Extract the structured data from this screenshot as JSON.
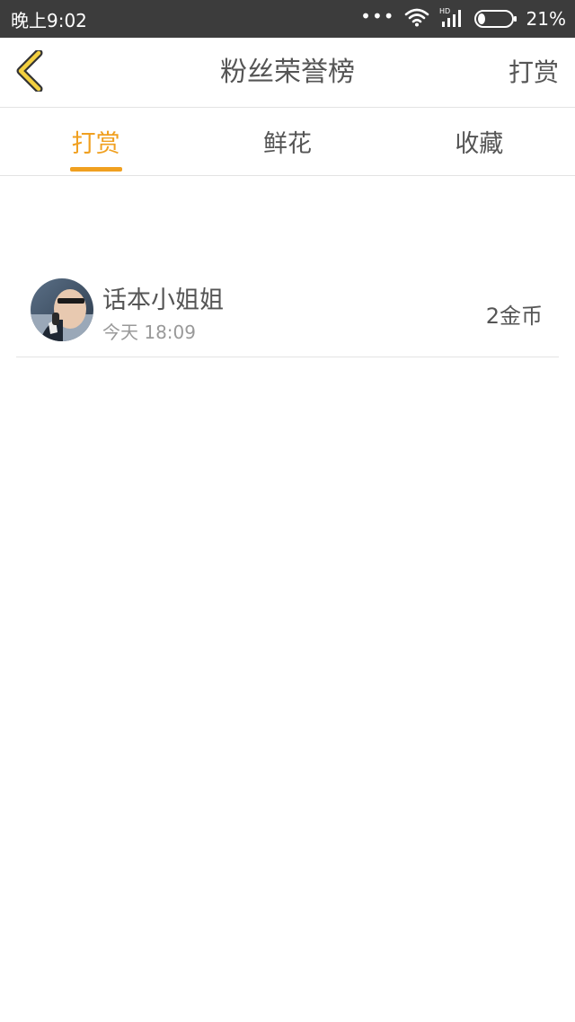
{
  "status_bar": {
    "time": "晚上9:02",
    "signal_type": "HD",
    "battery_percent": "21%",
    "battery_level": 0.21,
    "icons": [
      "more-dots-icon",
      "wifi-icon",
      "cellular-signal-icon",
      "battery-icon"
    ]
  },
  "nav": {
    "back_icon": "chevron-left-icon",
    "title": "粉丝荣誉榜",
    "action_label": "打赏"
  },
  "tabs": [
    {
      "label": "打赏",
      "active": true
    },
    {
      "label": "鲜花",
      "active": false
    },
    {
      "label": "收藏",
      "active": false
    }
  ],
  "list": {
    "items": [
      {
        "name": "话本小姐姐",
        "time": "今天 18:09",
        "amount": "2金币",
        "avatar": "user-avatar-photo"
      }
    ]
  },
  "colors": {
    "accent": "#f0a020",
    "status_bar": "#3c3c3c",
    "text_primary": "#555555",
    "text_secondary": "#999999",
    "divider": "#e3e3e3",
    "back_arrow_fill": "#f4d03f"
  }
}
